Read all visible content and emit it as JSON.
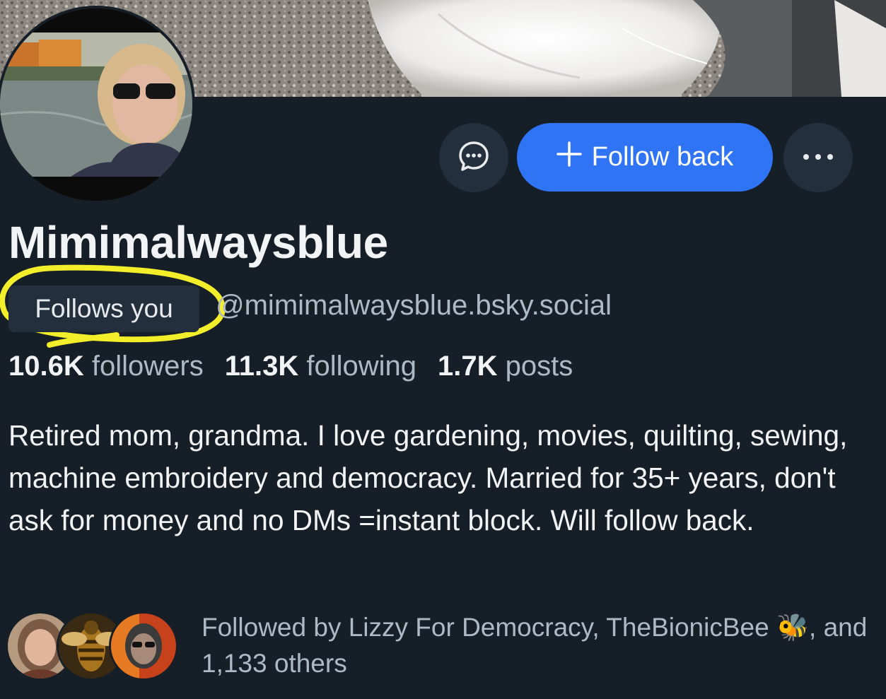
{
  "profile": {
    "display_name": "Mimimalwaysblue",
    "follows_you_label": "Follows you",
    "handle": "@mimimalwaysblue.bsky.social",
    "bio": "Retired mom, grandma. I love gardening, movies, quilting, sewing, machine embroidery and democracy. Married for 35+ years, don't ask for money and no DMs =instant block. Will follow back."
  },
  "actions": {
    "message_icon": "chat-bubble-icon",
    "follow_back_label": "Follow back",
    "follow_icon": "plus-icon",
    "more_icon": "ellipsis-icon"
  },
  "stats": {
    "followers_count": "10.6K",
    "followers_label": "followers",
    "following_count": "11.3K",
    "following_label": "following",
    "posts_count": "1.7K",
    "posts_label": "posts"
  },
  "followed_by": {
    "prefix": "Followed by Lizzy For Democracy, TheBionicBee",
    "emoji": "🐝",
    "suffix": ", and 1,133 others"
  },
  "colors": {
    "background": "#161e27",
    "accent": "#2f74f5",
    "secondary_text": "#aeb9c6",
    "chip": "#232f3d",
    "highlight_annotation": "#f2ee2a"
  }
}
